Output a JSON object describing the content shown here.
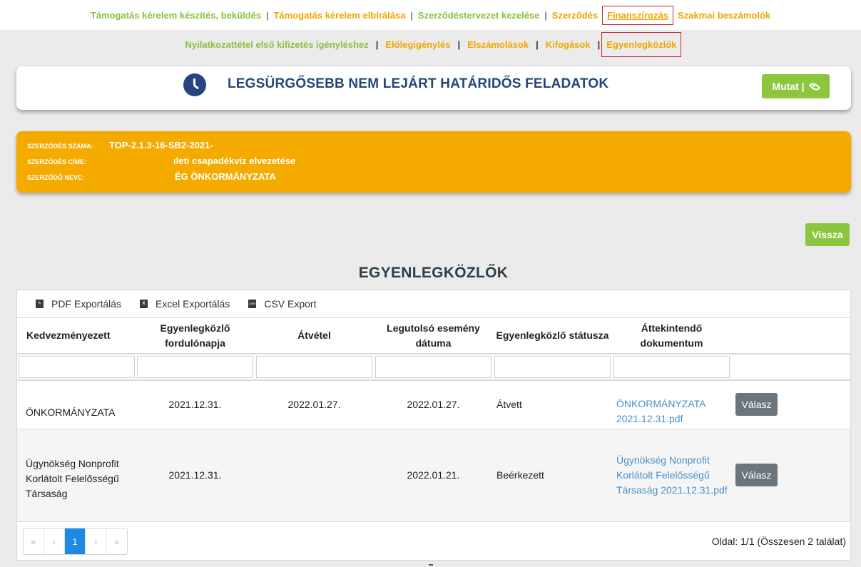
{
  "topnav": {
    "items": [
      {
        "label": "Támogatás kérelem készítés, beküldés",
        "color": "#8cbf3f"
      },
      {
        "label": "Támogatás kérelem elbírálása",
        "color": "#f0a500"
      },
      {
        "label": "Szerződéstervezet kezelése",
        "color": "#8cbf3f"
      },
      {
        "label": "Szerződés",
        "color": "#f0a500"
      },
      {
        "label": "Finanszírozás",
        "color": "#f0a500",
        "active": true
      },
      {
        "label": "Szakmai beszámolók",
        "color": "#f0a500"
      }
    ],
    "separator": "|"
  },
  "subnav": {
    "items": [
      {
        "label": "Nyilatkozattétel első kifizetés igényléshez",
        "color": "#8cbf3f"
      },
      {
        "label": "Előlegigénylés",
        "color": "#f0a500"
      },
      {
        "label": "Elszámolások",
        "color": "#f0a500"
      },
      {
        "label": "Kifogások",
        "color": "#f0a500"
      },
      {
        "label": "Egyenlegközlők",
        "color": "#f0a500",
        "active": true
      }
    ],
    "separator": "|"
  },
  "deadline": {
    "title": "LEGSÜRGŐSEBB NEM LEJÁRT HATÁRIDŐS FELADATOK",
    "show_label": "Mutat |",
    "icon": "clock-icon"
  },
  "contract": {
    "number_label": "SZERZŐDÉS SZÁMA:",
    "number_value": "TOP-2.1.3-16-SB2-2021-",
    "title_label": "SZERZŐDÉS CÍME:",
    "title_value": "ıleti csapadékvíz elvezetése",
    "name_label": "SZERZŐDŐ NEVE:",
    "name_value": "ÉG ÖNKORMÁNYZATA"
  },
  "back_label": "Vissza",
  "section_title": "EGYENLEGKÖZLŐK",
  "exports": [
    {
      "label": "PDF Exportálás",
      "icon": "pdf-icon"
    },
    {
      "label": "Excel Exportálás",
      "icon": "excel-icon"
    },
    {
      "label": "CSV Export",
      "icon": "csv-icon"
    }
  ],
  "table": {
    "headers": [
      "Kedvezményezett",
      "Egyenlegközlő fordulónapja",
      "Átvétel",
      "Legutolsó esemény dátuma",
      "Egyenlegközlő státusza",
      "Áttekintendő dokumentum",
      ""
    ],
    "rows": [
      {
        "beneficiary": "ÖNKORMÁNYZATA",
        "turn_date": "2021.12.31.",
        "received": "2022.01.27.",
        "last_event": "2022.01.27.",
        "status": "Átvett",
        "document": "ÖNKORMÁNYZATA 2021.12.31.pdf",
        "reply_label": "Válasz"
      },
      {
        "beneficiary": "Ügynökség Nonprofit Korlátolt Felelősségű Társaság",
        "turn_date": "2021.12.31.",
        "received": "",
        "last_event": "2022.01.21.",
        "status": "Beérkezett",
        "document": "Ügynökség Nonprofit Korlátolt Felelősségű Társaság 2021.12.31.pdf",
        "reply_label": "Válasz"
      }
    ]
  },
  "pager": {
    "first": "«",
    "prev": "‹",
    "current": "1",
    "next": "›",
    "last": "»",
    "info": "Oldal: 1/1 (Összesen 2 találat)"
  }
}
